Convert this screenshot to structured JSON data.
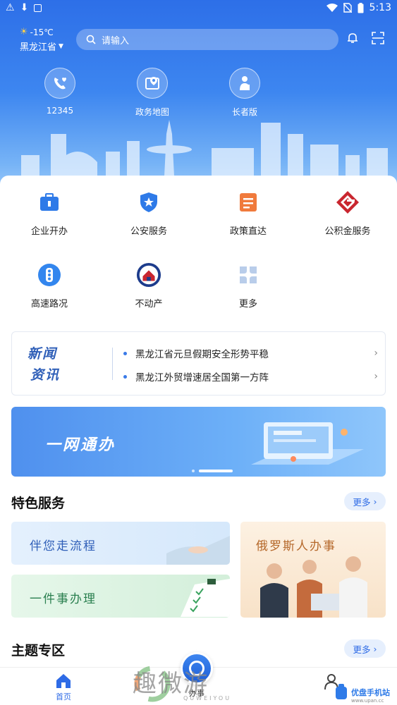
{
  "status_bar": {
    "time": "5:13"
  },
  "header": {
    "temperature": "-15℃",
    "province": "黑龙江省",
    "search_placeholder": "请输入"
  },
  "quick_links": [
    {
      "label": "12345",
      "icon": "phone-heart-icon"
    },
    {
      "label": "政务地图",
      "icon": "map-icon"
    },
    {
      "label": "长者版",
      "icon": "elder-icon"
    }
  ],
  "services": [
    {
      "label": "企业开办",
      "icon": "briefcase-icon"
    },
    {
      "label": "公安服务",
      "icon": "police-shield-icon"
    },
    {
      "label": "政策直达",
      "icon": "document-icon"
    },
    {
      "label": "公积金服务",
      "icon": "housing-fund-icon"
    },
    {
      "label": "高速路况",
      "icon": "traffic-light-icon"
    },
    {
      "label": "不动产",
      "icon": "real-estate-seal-icon"
    },
    {
      "label": "更多",
      "icon": "more-grid-icon"
    }
  ],
  "news": {
    "logo_line1": "新闻",
    "logo_line2": "资讯",
    "items": [
      "黑龙江省元旦假期安全形势平稳",
      "黑龙江外贸增速居全国第一方阵"
    ]
  },
  "banner": {
    "title": "一网通办"
  },
  "featured": {
    "title": "特色服务",
    "more": "更多",
    "cards": [
      "伴您走流程",
      "一件事办理",
      "俄罗斯人办事"
    ]
  },
  "topics": {
    "title": "主题专区",
    "more": "更多"
  },
  "tabbar": {
    "home": "首页",
    "work": "办事"
  },
  "watermark": {
    "text": "趣微游",
    "sub": "QUWEIYOU",
    "site": "优盘手机站",
    "url": "www.upan.cc"
  },
  "colors": {
    "primary": "#2e6be6",
    "hero_top": "#2d6fe8"
  }
}
